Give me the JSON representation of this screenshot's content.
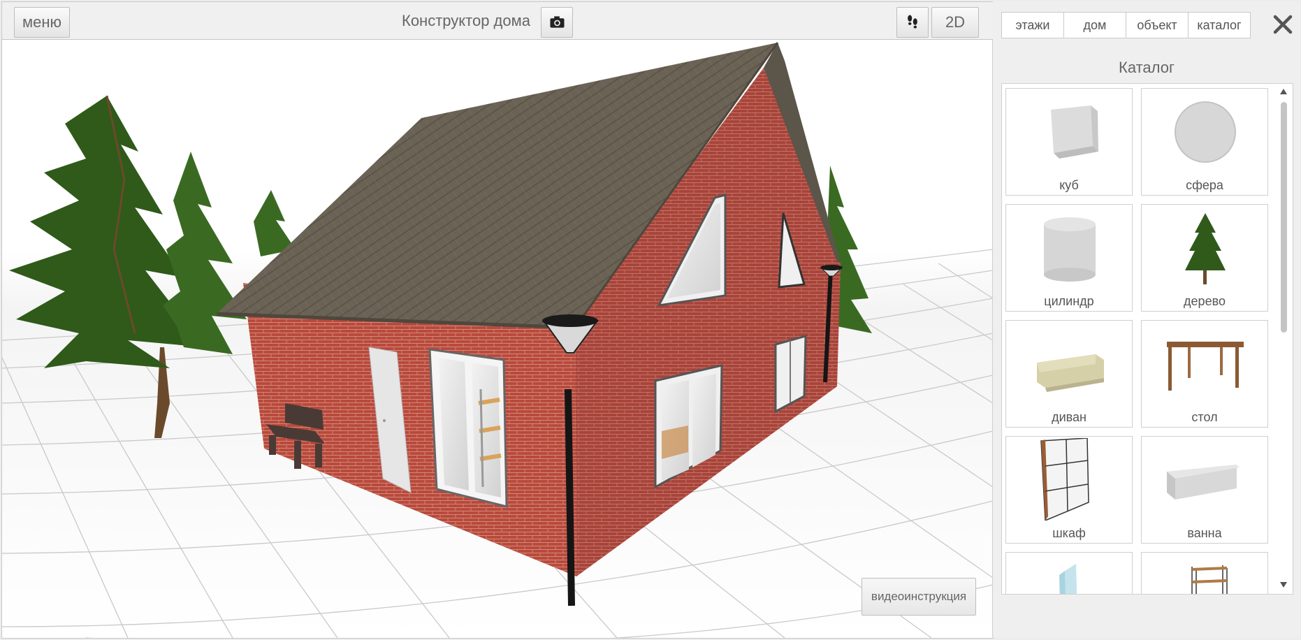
{
  "topbar": {
    "menu_label": "меню",
    "title": "Конструктор дома",
    "mode_label": "2D",
    "camera_icon": "camera-icon",
    "walk_icon": "footprints-icon"
  },
  "viewport": {
    "video_label": "видеоинструкция"
  },
  "panel": {
    "tabs": [
      {
        "label": "этажи"
      },
      {
        "label": "дом"
      },
      {
        "label": "объект"
      },
      {
        "label": "каталог"
      }
    ],
    "active_tab": "каталог",
    "close_icon": "close-icon",
    "title": "Каталог",
    "items": [
      {
        "label": "куб",
        "icon": "cube-icon"
      },
      {
        "label": "сфера",
        "icon": "sphere-icon"
      },
      {
        "label": "цилиндр",
        "icon": "cylinder-icon"
      },
      {
        "label": "дерево",
        "icon": "tree-icon"
      },
      {
        "label": "диван",
        "icon": "sofa-icon"
      },
      {
        "label": "стол",
        "icon": "table-icon"
      },
      {
        "label": "шкаф",
        "icon": "wardrobe-icon"
      },
      {
        "label": "ванна",
        "icon": "bathtub-icon"
      },
      {
        "label": "",
        "icon": "glass-partition-icon"
      },
      {
        "label": "",
        "icon": "shelf-rack-icon"
      }
    ]
  },
  "colors": {
    "brick": "#b94a3c",
    "roof": "#6b6356",
    "tree": "#2f5a1a",
    "grid_line": "#c9c9c9"
  }
}
